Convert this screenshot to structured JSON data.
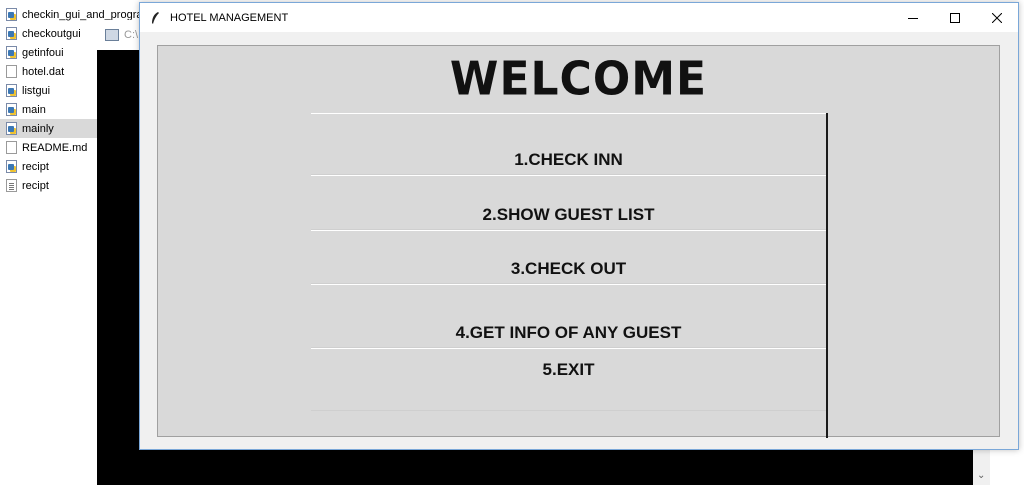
{
  "explorer": {
    "files": [
      {
        "name": "checkin_gui_and_progra",
        "icon": "python-file-icon"
      },
      {
        "name": "checkoutgui",
        "icon": "python-file-icon"
      },
      {
        "name": "getinfoui",
        "icon": "python-file-icon"
      },
      {
        "name": "hotel.dat",
        "icon": "blank-file-icon"
      },
      {
        "name": "listgui",
        "icon": "python-file-icon"
      },
      {
        "name": "main",
        "icon": "python-file-icon"
      },
      {
        "name": "mainly",
        "icon": "python-file-icon",
        "selected": true
      },
      {
        "name": "README.md",
        "icon": "blank-file-icon"
      },
      {
        "name": "recipt",
        "icon": "python-file-icon"
      },
      {
        "name": "recipt",
        "icon": "text-file-icon"
      }
    ]
  },
  "console": {
    "title": "C:\\"
  },
  "window": {
    "title": "HOTEL MANAGEMENT",
    "heading": "WELCOME",
    "buttons": [
      {
        "label": "1.CHECK INN"
      },
      {
        "label": "2.SHOW GUEST LIST"
      },
      {
        "label": "3.CHECK OUT"
      },
      {
        "label": "4.GET INFO OF ANY GUEST"
      },
      {
        "label": "5.EXIT"
      }
    ]
  },
  "colors": {
    "frame_bg": "#d9d9d9",
    "window_border": "#7aa7d8",
    "console_bg": "#000000"
  }
}
